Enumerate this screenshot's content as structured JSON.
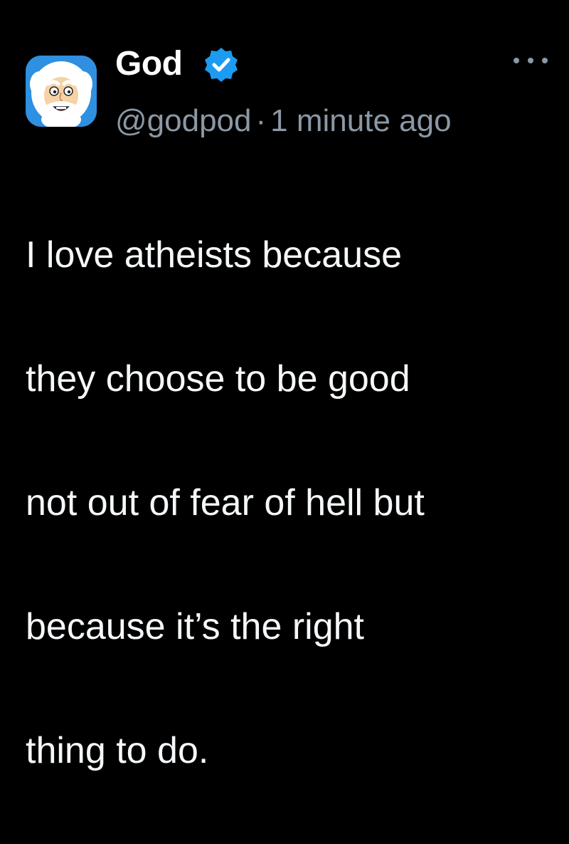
{
  "author": {
    "display_name": "God",
    "handle": "@godpod",
    "verified": true,
    "avatar_icon": "cartoon-god-avatar"
  },
  "meta": {
    "separator": "·",
    "timestamp": "1 minute ago"
  },
  "menu": {
    "icon": "more-options-icon"
  },
  "tweet": {
    "lines": [
      "I love atheists because",
      "they choose to be good",
      "not out of fear of hell but",
      "because it’s the right",
      "thing to do."
    ]
  },
  "colors": {
    "background": "#000000",
    "text": "#f5f8fa",
    "secondary_text": "#8b98a5",
    "verified_badge": "#1d9bf0",
    "avatar_bg": "#2f8fe0"
  }
}
